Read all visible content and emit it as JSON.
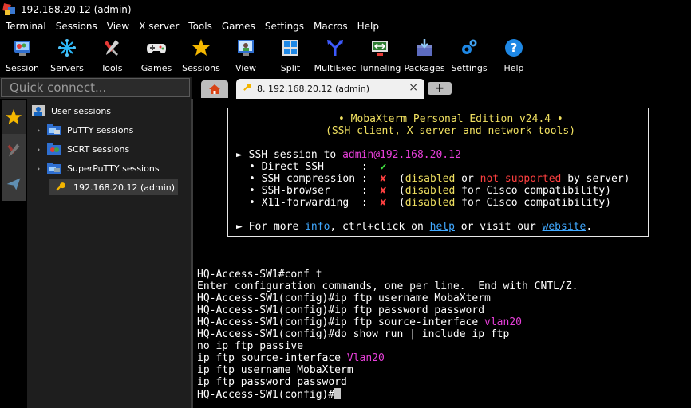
{
  "window": {
    "title": "192.168.20.12 (admin)"
  },
  "menu": [
    "Terminal",
    "Sessions",
    "View",
    "X server",
    "Tools",
    "Games",
    "Settings",
    "Macros",
    "Help"
  ],
  "toolbar": [
    {
      "label": "Session",
      "icon": "session-icon"
    },
    {
      "label": "Servers",
      "icon": "servers-icon"
    },
    {
      "label": "Tools",
      "icon": "tools-icon"
    },
    {
      "label": "Games",
      "icon": "games-icon"
    },
    {
      "label": "Sessions",
      "icon": "star-icon"
    },
    {
      "label": "View",
      "icon": "view-icon"
    },
    {
      "label": "Split",
      "icon": "split-icon"
    },
    {
      "label": "MultiExec",
      "icon": "multiexec-icon"
    },
    {
      "label": "Tunneling",
      "icon": "tunneling-icon"
    },
    {
      "label": "Packages",
      "icon": "packages-icon"
    },
    {
      "label": "Settings",
      "icon": "settings-icon"
    },
    {
      "label": "Help",
      "icon": "help-icon"
    }
  ],
  "quick_connect": {
    "placeholder": "Quick connect..."
  },
  "tabs": {
    "active_label": "8. 192.168.20.12 (admin)",
    "close": "×",
    "add": "+"
  },
  "sidebar": {
    "root": "User sessions",
    "folders": [
      "PuTTY sessions",
      "SCRT sessions",
      "SuperPuTTY sessions"
    ],
    "session": "192.168.20.12 (admin)"
  },
  "banner": {
    "line1": "• MobaXterm Personal Edition v24.4 •",
    "line2": "(SSH client, X server and network tools)",
    "ssh_prefix": "► SSH session to ",
    "ssh_target": "admin@192.168.20.12",
    "rows": [
      {
        "name": "• Direct SSH      :",
        "mark": "✔",
        "mark_color": "green",
        "note": []
      },
      {
        "name": "• SSH compression :",
        "mark": "✘",
        "mark_color": "red",
        "note": [
          "(",
          "disabled",
          " or ",
          "not supported",
          " by server)"
        ]
      },
      {
        "name": "• SSH-browser     :",
        "mark": "✘",
        "mark_color": "red",
        "note": [
          "(",
          "disabled",
          " for Cisco compatibility)"
        ]
      },
      {
        "name": "• X11-forwarding  :",
        "mark": "✘",
        "mark_color": "red",
        "note": [
          "(",
          "disabled",
          " for Cisco compatibility)"
        ]
      }
    ],
    "more": [
      "► For more ",
      "info",
      ", ctrl+click on ",
      "help",
      " or visit our ",
      "website",
      "."
    ]
  },
  "terminal_lines": [
    {
      "text": "HQ-Access-SW1#conf t",
      "hl": ""
    },
    {
      "text": "Enter configuration commands, one per line.  End with CNTL/Z.",
      "hl": ""
    },
    {
      "text": "HQ-Access-SW1(config)#ip ftp username MobaXterm",
      "hl": ""
    },
    {
      "text": "HQ-Access-SW1(config)#ip ftp password password",
      "hl": ""
    },
    {
      "text": "HQ-Access-SW1(config)#ip ftp source-interface ",
      "hl": "vlan20"
    },
    {
      "text": "HQ-Access-SW1(config)#do show run | include ip ftp",
      "hl": ""
    },
    {
      "text": "no ip ftp passive",
      "hl": ""
    },
    {
      "text": "ip ftp source-interface ",
      "hl": "Vlan20"
    },
    {
      "text": "ip ftp username MobaXterm",
      "hl": ""
    },
    {
      "text": "ip ftp password password",
      "hl": ""
    },
    {
      "text": "HQ-Access-SW1(config)#",
      "hl": "",
      "cursor": true
    }
  ],
  "colors": {
    "yellow": "#f0e060",
    "magenta": "#e63fd8",
    "red": "#ff4040",
    "green": "#40e040",
    "blue": "#40a8ff"
  }
}
